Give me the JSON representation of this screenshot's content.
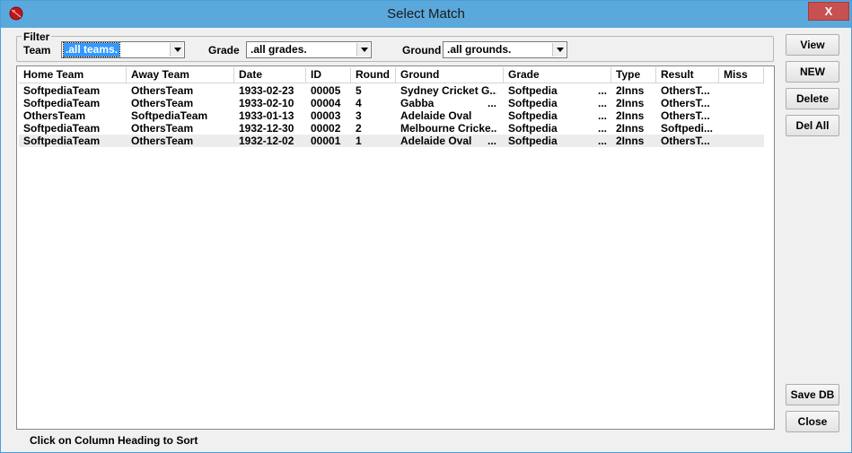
{
  "window": {
    "title": "Select Match",
    "close_label": "X"
  },
  "filter": {
    "legend": "Filter",
    "team_label": "Team",
    "team_value": ".all teams.",
    "grade_label": "Grade",
    "grade_value": ".all grades.",
    "ground_label": "Ground",
    "ground_value": ".all grounds."
  },
  "buttons": {
    "view": "View",
    "new": "NEW",
    "delete": "Delete",
    "del_all": "Del All",
    "save_db": "Save DB",
    "close": "Close"
  },
  "table": {
    "columns": [
      "Home Team",
      "Away Team",
      "Date",
      "ID",
      "Round",
      "Ground",
      "Grade",
      "Type",
      "Result",
      "Miss"
    ],
    "rows": [
      [
        "SoftpediaTeam",
        "OthersTeam",
        "1933-02-23",
        "00005",
        "5",
        "Sydney Cricket G...",
        "Softpedia",
        "...",
        "2Inns",
        "OthersT...",
        ""
      ],
      [
        "SoftpediaTeam",
        "OthersTeam",
        "1933-02-10",
        "00004",
        "4",
        "Gabba",
        "Softpedia",
        "...",
        "2Inns",
        "OthersT...",
        ""
      ],
      [
        "OthersTeam",
        "SoftpediaTeam",
        "1933-01-13",
        "00003",
        "3",
        "Adelaide Oval",
        "Softpedia",
        "...",
        "2Inns",
        "OthersT...",
        ""
      ],
      [
        "SoftpediaTeam",
        "OthersTeam",
        "1932-12-30",
        "00002",
        "2",
        "Melbourne Cricke...",
        "Softpedia",
        "...",
        "2Inns",
        "Softpedi...",
        ""
      ],
      [
        "SoftpediaTeam",
        "OthersTeam",
        "1932-12-02",
        "00001",
        "1",
        "Adelaide Oval",
        "Softpedia",
        "...",
        "2Inns",
        "OthersT...",
        ""
      ]
    ],
    "ground_trailing": [
      "",
      "...",
      "",
      "",
      "..."
    ]
  },
  "status": {
    "text": "Click on Column Heading to Sort"
  },
  "colors": {
    "titlebar": "#5ba8dc",
    "selection": "#3399ff",
    "close": "#c75050"
  },
  "icons": {
    "app": "cricket-ball-icon",
    "dropdown": "chevron-down-icon"
  }
}
